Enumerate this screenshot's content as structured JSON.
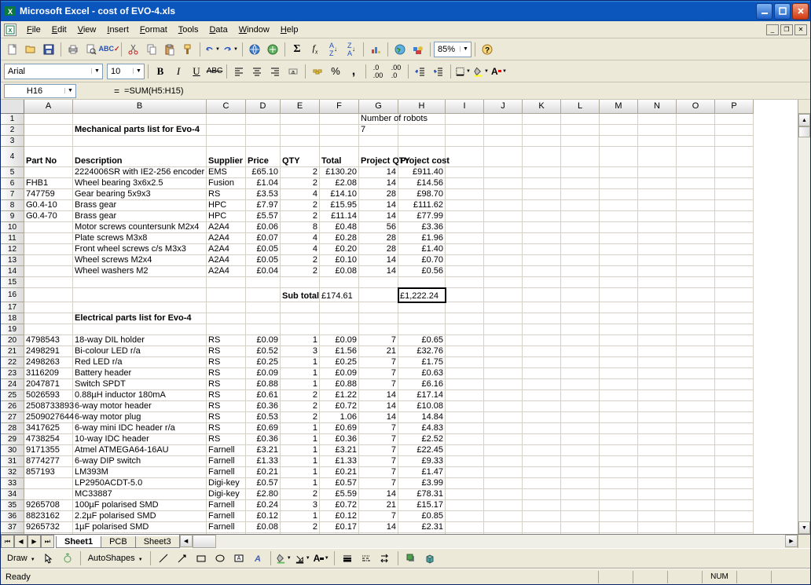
{
  "window": {
    "app_title": "Microsoft Excel - cost of EVO-4.xls"
  },
  "menus": [
    "File",
    "Edit",
    "View",
    "Insert",
    "Format",
    "Tools",
    "Data",
    "Window",
    "Help"
  ],
  "font": {
    "name": "Arial",
    "size": "10"
  },
  "zoom": "85%",
  "name_box": "H16",
  "formula": "=SUM(H5:H15)",
  "status": "Ready",
  "status_num": "NUM",
  "sheet_tabs": [
    "Sheet1",
    "PCB",
    "Sheet3"
  ],
  "draw_label": "Draw",
  "autoshapes": "AutoShapes",
  "headers": {
    "row4": {
      "A": "Part No",
      "B": "Description",
      "C": "Supplier",
      "D": "Price",
      "E": "QTY",
      "F": "Total",
      "G": "Project QTY",
      "H": "Project cost"
    },
    "row1": {
      "G": "Number of robots"
    },
    "row2": {
      "G": "7"
    },
    "mech_title": "Mechanical parts list for Evo-4",
    "elec_title": "Electrical parts list for Evo-4",
    "subtotal": "Sub total"
  },
  "chart_data": {
    "type": "table",
    "sections": [
      {
        "title": "Mechanical parts list for Evo-4",
        "columns": [
          "Part No",
          "Description",
          "Supplier",
          "Price",
          "QTY",
          "Total",
          "Project QTY",
          "Project cost"
        ],
        "rows": [
          [
            "",
            "2224006SR with IE2-256 encoder",
            "EMS",
            "£65.10",
            2,
            "£130.20",
            14,
            "£911.40"
          ],
          [
            "FHB1",
            "Wheel bearing 3x6x2.5",
            "Fusion",
            "£1.04",
            2,
            "£2.08",
            14,
            "£14.56"
          ],
          [
            "747759",
            "Gear bearing 5x9x3",
            "RS",
            "£3.53",
            4,
            "£14.10",
            28,
            "£98.70"
          ],
          [
            "G0.4-10",
            "Brass gear",
            "HPC",
            "£7.97",
            2,
            "£15.95",
            14,
            "£111.62"
          ],
          [
            "G0.4-70",
            "Brass gear",
            "HPC",
            "£5.57",
            2,
            "£11.14",
            14,
            "£77.99"
          ],
          [
            "",
            "Motor screws countersunk M2x4",
            "A2A4",
            "£0.06",
            8,
            "£0.48",
            56,
            "£3.36"
          ],
          [
            "",
            "Plate screws M3x8",
            "A2A4",
            "£0.07",
            4,
            "£0.28",
            28,
            "£1.96"
          ],
          [
            "",
            "Front wheel screws c/s M3x3",
            "A2A4",
            "£0.05",
            4,
            "£0.20",
            28,
            "£1.40"
          ],
          [
            "",
            "Wheel screws M2x4",
            "A2A4",
            "£0.05",
            2,
            "£0.10",
            14,
            "£0.70"
          ],
          [
            "",
            "Wheel washers M2",
            "A2A4",
            "£0.04",
            2,
            "£0.08",
            14,
            "£0.56"
          ]
        ],
        "subtotal": {
          "F": "£174.61",
          "H": "£1,222.24"
        }
      },
      {
        "title": "Electrical parts list for Evo-4",
        "columns": [
          "Part No",
          "Description",
          "Supplier",
          "Price",
          "QTY",
          "Total",
          "Project QTY",
          "Project cost"
        ],
        "rows": [
          [
            "4798543",
            "18-way DIL holder",
            "RS",
            "£0.09",
            1,
            "£0.09",
            7,
            "£0.65"
          ],
          [
            "2498291",
            "Bi-colour LED r/a",
            "RS",
            "£0.52",
            3,
            "£1.56",
            21,
            "£32.76"
          ],
          [
            "2498263",
            "Red LED r/a",
            "RS",
            "£0.25",
            1,
            "£0.25",
            7,
            "£1.75"
          ],
          [
            "3116209",
            "Battery header",
            "RS",
            "£0.09",
            1,
            "£0.09",
            7,
            "£0.63"
          ],
          [
            "2047871",
            "Switch SPDT",
            "RS",
            "£0.88",
            1,
            "£0.88",
            7,
            "£6.16"
          ],
          [
            "5026593",
            "0.88µH inductor 180mA",
            "RS",
            "£0.61",
            2,
            "£1.22",
            14,
            "£17.14"
          ],
          [
            "2508733893",
            "6-way motor header",
            "RS",
            "£0.36",
            2,
            "£0.72",
            14,
            "£10.08"
          ],
          [
            "2509027644",
            "6-way motor plug",
            "RS",
            "£0.53",
            2,
            "1.06",
            14,
            "14.84"
          ],
          [
            "3417625",
            "6-way mini IDC header r/a",
            "RS",
            "£0.69",
            1,
            "£0.69",
            7,
            "£4.83"
          ],
          [
            "4738254",
            "10-way IDC header",
            "RS",
            "£0.36",
            1,
            "£0.36",
            7,
            "£2.52"
          ],
          [
            "9171355",
            "Atmel ATMEGA64-16AU",
            "Farnell",
            "£3.21",
            1,
            "£3.21",
            7,
            "£22.45"
          ],
          [
            "8774277",
            "6-way DIP switch",
            "Farnell",
            "£1.33",
            1,
            "£1.33",
            7,
            "£9.33"
          ],
          [
            "857193",
            "LM393M",
            "Farnell",
            "£0.21",
            1,
            "£0.21",
            7,
            "£1.47"
          ],
          [
            "",
            "LP2950ACDT-5.0",
            "Digi-key",
            "£0.57",
            1,
            "£0.57",
            7,
            "£3.99"
          ],
          [
            "",
            "MC33887",
            "Digi-key",
            "£2.80",
            2,
            "£5.59",
            14,
            "£78.31"
          ],
          [
            "9265708",
            "100µF polarised SMD",
            "Farnell",
            "£0.24",
            3,
            "£0.72",
            21,
            "£15.17"
          ],
          [
            "8823162",
            "2.2µF polarised SMD",
            "Farnell",
            "£0.12",
            1,
            "£0.12",
            7,
            "£0.85"
          ],
          [
            "9265732",
            "1µF polarised SMD",
            "Farnell",
            "£0.08",
            2,
            "£0.17",
            14,
            "£2.31"
          ]
        ]
      }
    ]
  },
  "mech_rows": [
    {
      "r": 5,
      "A": "",
      "B": "2224006SR with IE2-256 encoder",
      "C": "EMS",
      "D": "£65.10",
      "E": "2",
      "F": "£130.20",
      "G": "14",
      "H": "£911.40"
    },
    {
      "r": 6,
      "A": "FHB1",
      "B": "Wheel bearing 3x6x2.5",
      "C": "Fusion",
      "D": "£1.04",
      "E": "2",
      "F": "£2.08",
      "G": "14",
      "H": "£14.56"
    },
    {
      "r": 7,
      "A": "747759",
      "B": "Gear bearing 5x9x3",
      "C": "RS",
      "D": "£3.53",
      "E": "4",
      "F": "£14.10",
      "G": "28",
      "H": "£98.70"
    },
    {
      "r": 8,
      "A": "G0.4-10",
      "B": "Brass gear",
      "C": "HPC",
      "D": "£7.97",
      "E": "2",
      "F": "£15.95",
      "G": "14",
      "H": "£111.62"
    },
    {
      "r": 9,
      "A": "G0.4-70",
      "B": "Brass gear",
      "C": "HPC",
      "D": "£5.57",
      "E": "2",
      "F": "£11.14",
      "G": "14",
      "H": "£77.99"
    },
    {
      "r": 10,
      "A": "",
      "B": "Motor screws countersunk M2x4",
      "C": "A2A4",
      "D": "£0.06",
      "E": "8",
      "F": "£0.48",
      "G": "56",
      "H": "£3.36"
    },
    {
      "r": 11,
      "A": "",
      "B": "Plate screws M3x8",
      "C": "A2A4",
      "D": "£0.07",
      "E": "4",
      "F": "£0.28",
      "G": "28",
      "H": "£1.96"
    },
    {
      "r": 12,
      "A": "",
      "B": "Front wheel screws c/s M3x3",
      "C": "A2A4",
      "D": "£0.05",
      "E": "4",
      "F": "£0.20",
      "G": "28",
      "H": "£1.40"
    },
    {
      "r": 13,
      "A": "",
      "B": "Wheel screws M2x4",
      "C": "A2A4",
      "D": "£0.05",
      "E": "2",
      "F": "£0.10",
      "G": "14",
      "H": "£0.70"
    },
    {
      "r": 14,
      "A": "",
      "B": "Wheel washers M2",
      "C": "A2A4",
      "D": "£0.04",
      "E": "2",
      "F": "£0.08",
      "G": "14",
      "H": "£0.56"
    }
  ],
  "subtotal_row": {
    "F": "£174.61",
    "H": "£1,222.24"
  },
  "elec_rows": [
    {
      "r": 20,
      "A": "4798543",
      "B": "18-way DIL holder",
      "C": "RS",
      "D": "£0.09",
      "E": "1",
      "F": "£0.09",
      "G": "7",
      "H": "£0.65"
    },
    {
      "r": 21,
      "A": "2498291",
      "B": "Bi-colour LED r/a",
      "C": "RS",
      "D": "£0.52",
      "E": "3",
      "F": "£1.56",
      "G": "21",
      "H": "£32.76"
    },
    {
      "r": 22,
      "A": "2498263",
      "B": "Red LED r/a",
      "C": "RS",
      "D": "£0.25",
      "E": "1",
      "F": "£0.25",
      "G": "7",
      "H": "£1.75"
    },
    {
      "r": 23,
      "A": "3116209",
      "B": "Battery header",
      "C": "RS",
      "D": "£0.09",
      "E": "1",
      "F": "£0.09",
      "G": "7",
      "H": "£0.63"
    },
    {
      "r": 24,
      "A": "2047871",
      "B": "Switch SPDT",
      "C": "RS",
      "D": "£0.88",
      "E": "1",
      "F": "£0.88",
      "G": "7",
      "H": "£6.16"
    },
    {
      "r": 25,
      "A": "5026593",
      "B": "0.88µH inductor 180mA",
      "C": "RS",
      "D": "£0.61",
      "E": "2",
      "F": "£1.22",
      "G": "14",
      "H": "£17.14"
    },
    {
      "r": 26,
      "A": "2508733893",
      "B": "6-way motor header",
      "C": "RS",
      "D": "£0.36",
      "E": "2",
      "F": "£0.72",
      "G": "14",
      "H": "£10.08"
    },
    {
      "r": 27,
      "A": "2509027644",
      "B": "6-way motor plug",
      "C": "RS",
      "D": "£0.53",
      "E": "2",
      "F": "1.06",
      "G": "14",
      "H": "14.84"
    },
    {
      "r": 28,
      "A": "3417625",
      "B": "6-way mini IDC header r/a",
      "C": "RS",
      "D": "£0.69",
      "E": "1",
      "F": "£0.69",
      "G": "7",
      "H": "£4.83"
    },
    {
      "r": 29,
      "A": "4738254",
      "B": "10-way IDC header",
      "C": "RS",
      "D": "£0.36",
      "E": "1",
      "F": "£0.36",
      "G": "7",
      "H": "£2.52"
    },
    {
      "r": 30,
      "A": "9171355",
      "B": "Atmel ATMEGA64-16AU",
      "C": "Farnell",
      "D": "£3.21",
      "E": "1",
      "F": "£3.21",
      "G": "7",
      "H": "£22.45"
    },
    {
      "r": 31,
      "A": "8774277",
      "B": "6-way DIP switch",
      "C": "Farnell",
      "D": "£1.33",
      "E": "1",
      "F": "£1.33",
      "G": "7",
      "H": "£9.33"
    },
    {
      "r": 32,
      "A": "857193",
      "B": "LM393M",
      "C": "Farnell",
      "D": "£0.21",
      "E": "1",
      "F": "£0.21",
      "G": "7",
      "H": "£1.47"
    },
    {
      "r": 33,
      "A": "",
      "B": "LP2950ACDT-5.0",
      "C": "Digi-key",
      "D": "£0.57",
      "E": "1",
      "F": "£0.57",
      "G": "7",
      "H": "£3.99"
    },
    {
      "r": 34,
      "A": "",
      "B": "MC33887",
      "C": "Digi-key",
      "D": "£2.80",
      "E": "2",
      "F": "£5.59",
      "G": "14",
      "H": "£78.31"
    },
    {
      "r": 35,
      "A": "9265708",
      "B": "100µF polarised SMD",
      "C": "Farnell",
      "D": "£0.24",
      "E": "3",
      "F": "£0.72",
      "G": "21",
      "H": "£15.17"
    },
    {
      "r": 36,
      "A": "8823162",
      "B": "2.2µF polarised SMD",
      "C": "Farnell",
      "D": "£0.12",
      "E": "1",
      "F": "£0.12",
      "G": "7",
      "H": "£0.85"
    },
    {
      "r": 37,
      "A": "9265732",
      "B": "1µF polarised SMD",
      "C": "Farnell",
      "D": "£0.08",
      "E": "2",
      "F": "£0.17",
      "G": "14",
      "H": "£2.31"
    }
  ]
}
